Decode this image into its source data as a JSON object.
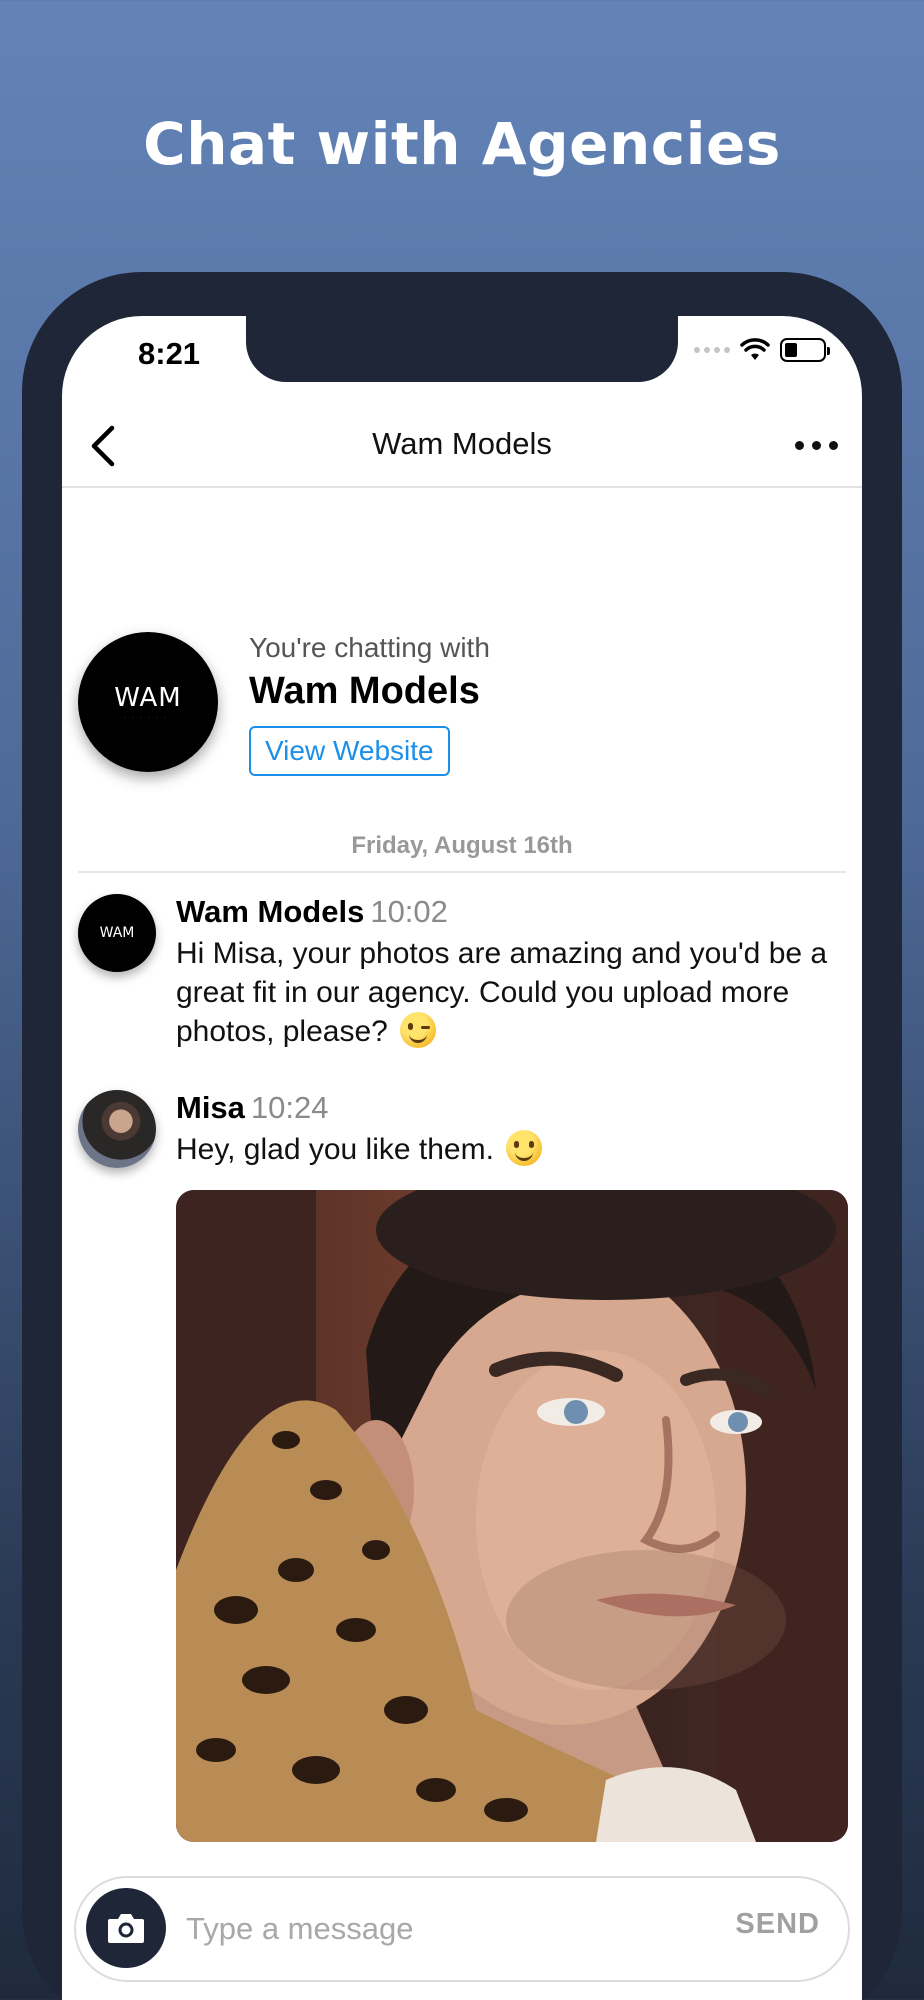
{
  "headline": "Chat with Agencies",
  "status_bar": {
    "time": "8:21"
  },
  "nav": {
    "title": "Wam Models"
  },
  "agency": {
    "chatting_with": "You're chatting with",
    "name": "Wam Models",
    "view_website": "View Website",
    "logo": "WAM"
  },
  "date_separator": "Friday, August 16th",
  "messages": [
    {
      "sender": "Wam Models",
      "time": "10:02",
      "text": "Hi Misa, your photos are amazing and you'd be a great fit in our agency. Could you upload more photos, please?",
      "emoji": "winking-face"
    },
    {
      "sender": "Misa",
      "time": "10:24",
      "text": "Hey, glad you like them.",
      "emoji": "smiling-face",
      "attachment": "portrait-photo"
    }
  ],
  "composer": {
    "placeholder": "Type a message",
    "send_label": "SEND"
  },
  "colors": {
    "accent": "#1c8fe8",
    "dark": "#1e2638",
    "background_top": "#6383b7"
  }
}
